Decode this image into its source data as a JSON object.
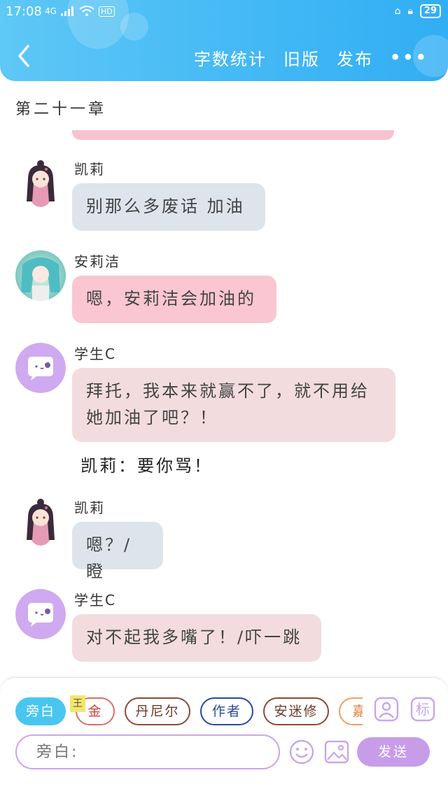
{
  "status_bar": {
    "time": "17:08",
    "network": "4G",
    "wifi_badge": "HD",
    "battery": "29"
  },
  "header": {
    "actions": [
      "字数统计",
      "旧版",
      "发布"
    ],
    "more": "•••",
    "accent_color": "#44b9f5"
  },
  "chapter_title": "第二十一章",
  "messages": [
    {
      "sender": "凯莉",
      "text": "别那么多废话 加油",
      "style": "gray",
      "avatar": "girl-avatar"
    },
    {
      "sender": "安莉洁",
      "text": "嗯，安莉洁会加油的",
      "style": "pink",
      "avatar": "teal-hair-avatar"
    },
    {
      "sender": "学生C",
      "line1": "拜托，我本来就赢不了，就不用给",
      "line2": "她加油了吧？！",
      "style": "rose",
      "avatar": "chat-bubble-avatar"
    },
    {
      "sender": "凯莉",
      "text": "嗯？/瞪",
      "style": "gray",
      "avatar": "girl-avatar"
    },
    {
      "sender": "学生C",
      "text": "对不起我多嘴了！/吓一跳",
      "style": "rose",
      "avatar": "chat-bubble-avatar"
    }
  ],
  "narration": "凯莉：要你骂！",
  "composer": {
    "roles": [
      "旁白",
      "金",
      "丹尼尔",
      "作者",
      "安迷修",
      "嘉"
    ],
    "role_colors": [
      "#49c6f0",
      "#e26a6a",
      "#8a4a3a",
      "#2a4a9a",
      "#8a4a3a",
      "#f0a060"
    ],
    "sticky": "王",
    "input_placeholder": "旁白:",
    "send_label": "发送",
    "tag_label": "标"
  }
}
